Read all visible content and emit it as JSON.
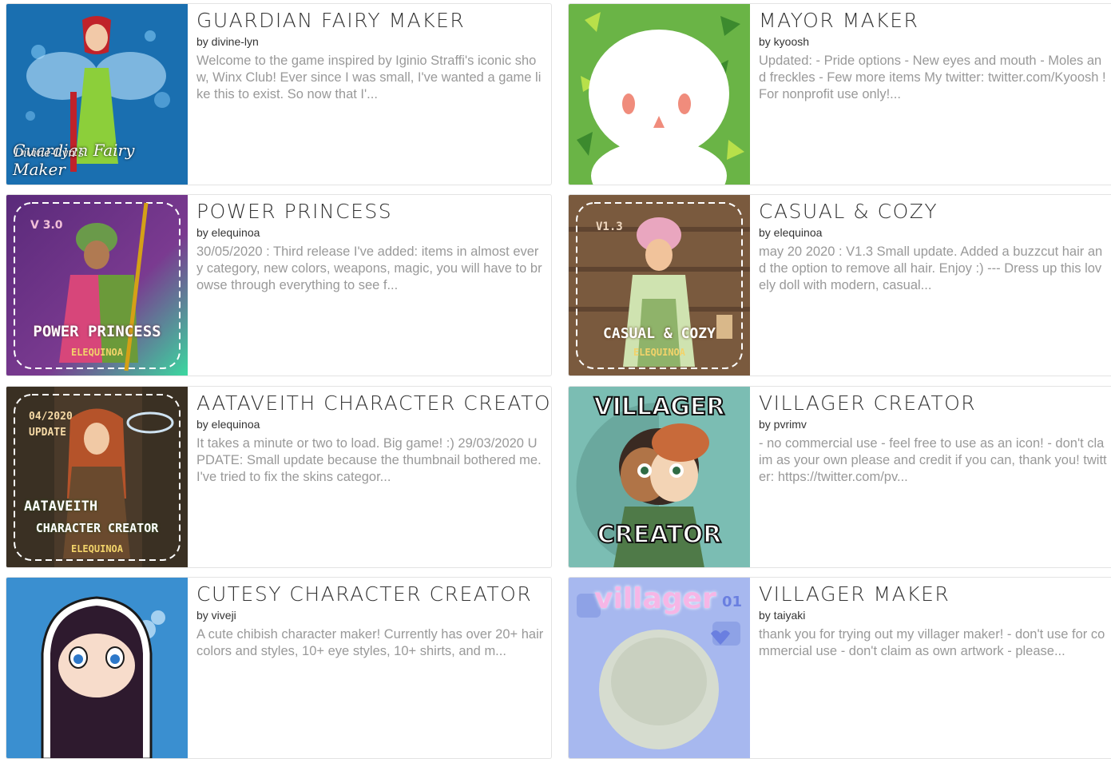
{
  "cards": [
    {
      "title": "GUARDIAN FAIRY MAKER",
      "author": "by divine-lyn",
      "description": "Welcome to the game inspired by Iginio Straffi's iconic show, Winx Club! Ever since I was small, I've wanted a game like this to exist. So now that I'...",
      "thumb_text": [
        "Divine-Lyn's",
        "Guardian Fairy Maker"
      ]
    },
    {
      "title": "MAYOR MAKER",
      "author": "by kyoosh",
      "description": "Updated: - Pride options - New eyes and mouth - Moles and freckles - Few more items My twitter: twitter.com/Kyoosh !For nonprofit use only!...",
      "thumb_text": []
    },
    {
      "title": "POWER PRINCESS",
      "author": "by elequinoa",
      "description": "30/05/2020 : Third release I've added: items in almost every category, new colors, weapons, magic, you will have to browse through everything to see f...",
      "thumb_text": [
        "V 3.0",
        "POWER PRINCESS",
        "ELEQUINOA"
      ]
    },
    {
      "title": "CASUAL & COZY",
      "author": "by elequinoa",
      "description": "may 20 2020 : V1.3 Small update. Added a buzzcut hair and the option to remove all hair. Enjoy :) --- Dress up this lovely doll with modern, casual...",
      "thumb_text": [
        "V1.3",
        "CASUAL & COZY",
        "ELEQUINOA"
      ]
    },
    {
      "title": "AATAVEITH CHARACTER CREATOR",
      "author": "by elequinoa",
      "description": "It takes a minute or two to load. Big game! :) 29/03/2020 UPDATE: Small update because the thumbnail bothered me. I've tried to fix the skins categor...",
      "thumb_text": [
        "04/2020",
        "UPDATE",
        "AATAVEITH",
        "CHARACTER CREATOR",
        "ELEQUINOA"
      ]
    },
    {
      "title": "VILLAGER CREATOR",
      "author": "by pvrimv",
      "description": "- no commercial use - feel free to use as an icon! - don't claim as your own please and credit if you can, thank you! twitter: https://twitter.com/pv...",
      "thumb_text": [
        "VILLAGER",
        "CREATOR"
      ]
    },
    {
      "title": "CUTESY CHARACTER CREATOR",
      "author": "by viveji",
      "description": "A cute chibish character maker! Currently has over 20+ hair colors and styles, 10+ eye styles, 10+ shirts, and m...",
      "thumb_text": []
    },
    {
      "title": "VILLAGER MAKER",
      "author": "by taiyaki",
      "description": "thank you for trying out my villager maker! - don't use for commercial use - don't claim as own artwork - please...",
      "thumb_text": [
        "villager",
        "01"
      ]
    }
  ],
  "colors": {
    "title": "#333333",
    "author": "#333333",
    "description": "#999999",
    "border": "#e3e3e3"
  }
}
